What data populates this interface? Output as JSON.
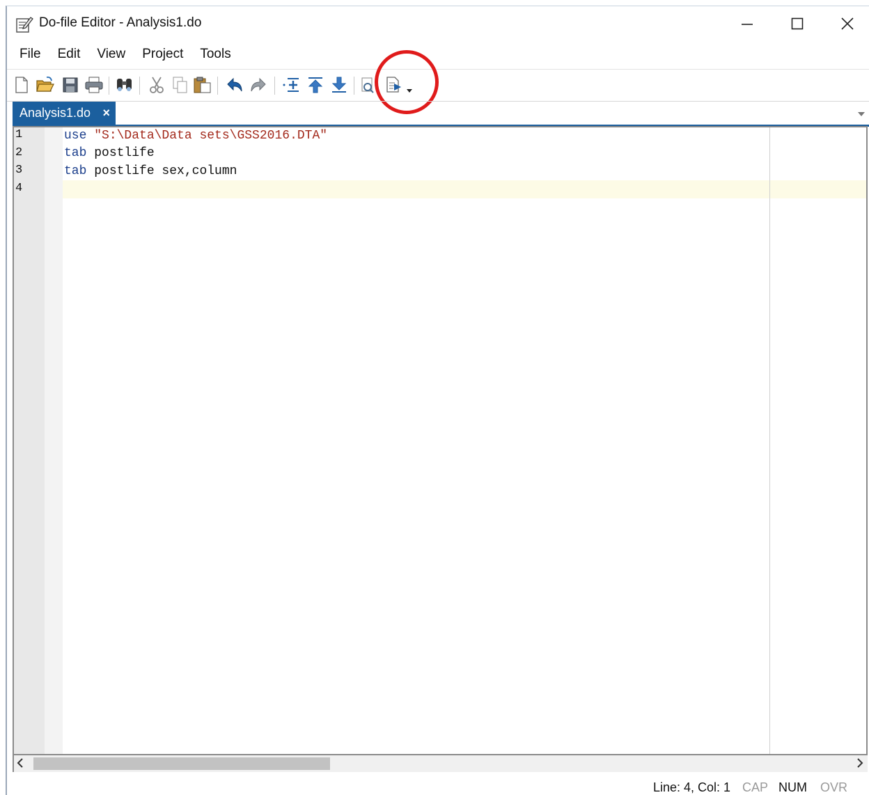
{
  "window": {
    "title": "Do-file Editor - Analysis1.do"
  },
  "menu": [
    "File",
    "Edit",
    "View",
    "Project",
    "Tools"
  ],
  "toolbar": {
    "icons": [
      "new-icon",
      "open-icon",
      "save-icon",
      "print-icon",
      "find-icon",
      "cut-icon",
      "copy-icon",
      "paste-icon",
      "undo-icon",
      "redo-icon",
      "toggle-bookmark-icon",
      "previous-bookmark-icon",
      "next-bookmark-icon",
      "show-file-in-viewer-icon",
      "execute-icon"
    ],
    "highlight_color": "#e01b1b"
  },
  "tab": {
    "label": "Analysis1.do",
    "close": "×",
    "color": "#1b5f9e"
  },
  "editor": {
    "lines": [
      {
        "no": "1",
        "kw": "use",
        "rest": "\"S:\\Data\\Data sets\\GSS2016.DTA\"",
        "rest_type": "string"
      },
      {
        "no": "2",
        "kw": "tab",
        "rest": "postlife",
        "rest_type": "text"
      },
      {
        "no": "3",
        "kw": "tab",
        "rest": "postlife sex,column",
        "rest_type": "text"
      },
      {
        "no": "4",
        "kw": "",
        "rest": "",
        "rest_type": "text"
      }
    ],
    "current_line": 4
  },
  "status": {
    "position": "Line: 4, Col: 1",
    "cap": "CAP",
    "num": "NUM",
    "ovr": "OVR"
  }
}
